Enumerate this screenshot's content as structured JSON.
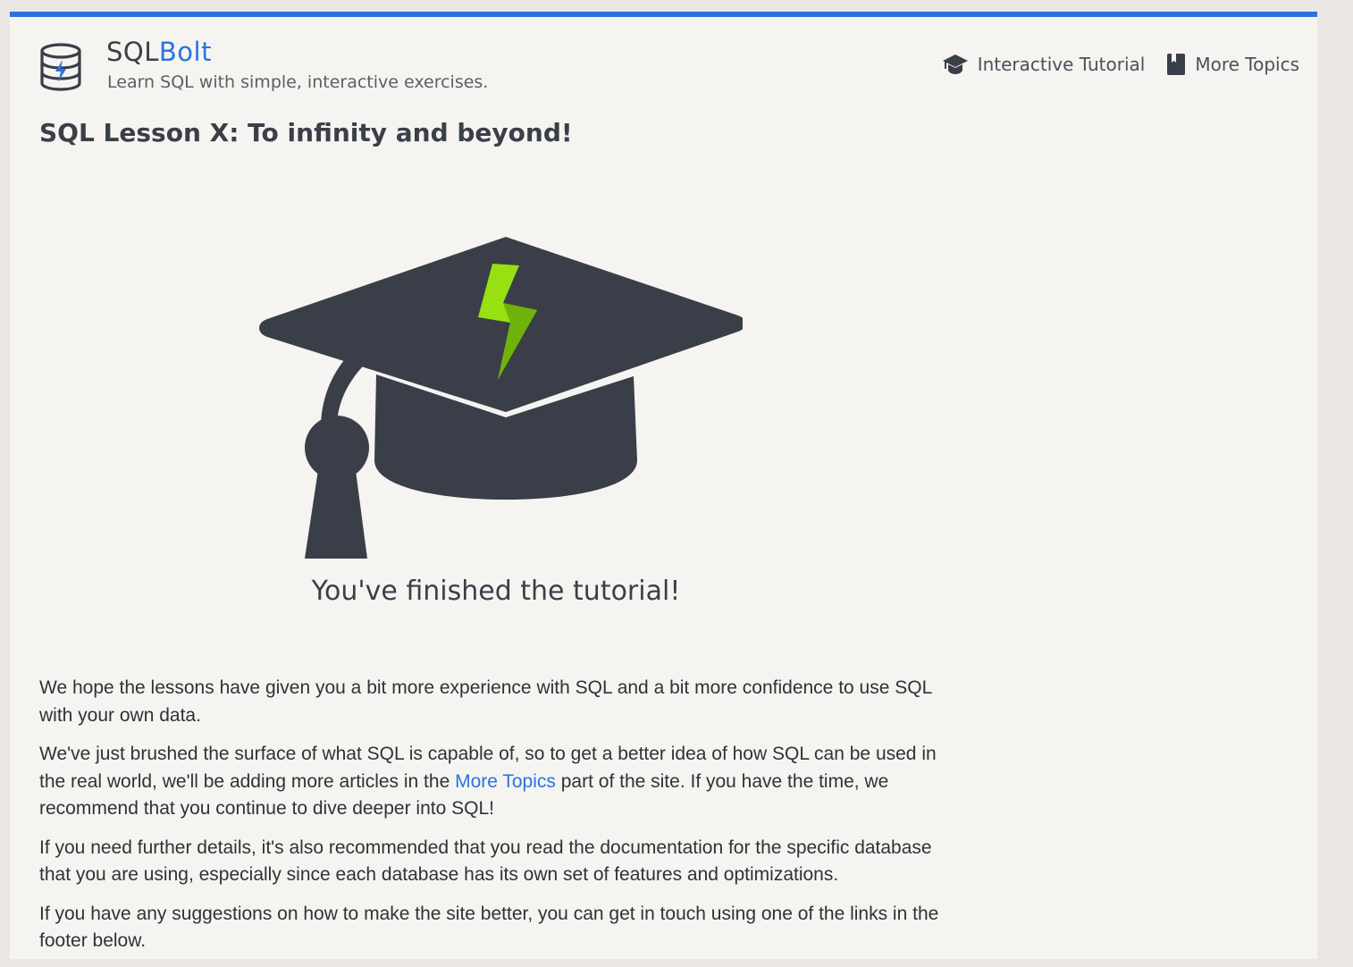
{
  "header": {
    "brand_prefix": "SQL",
    "brand_suffix": "Bolt",
    "tagline": "Learn SQL with simple, interactive exercises.",
    "nav": [
      {
        "label": "Interactive Tutorial",
        "icon": "graduation-cap-icon"
      },
      {
        "label": "More Topics",
        "icon": "book-icon"
      }
    ]
  },
  "lesson": {
    "title": "SQL Lesson X: To infinity and beyond!",
    "hero_caption": "You've finished the tutorial!"
  },
  "body": {
    "p1": "We hope the lessons have given you a bit more experience with SQL and a bit more confidence to use SQL with your own data.",
    "p2_before": "We've just brushed the surface of what SQL is capable of, so to get a better idea of how SQL can be used in the real world, we'll be adding more articles in the ",
    "p2_link": "More Topics",
    "p2_after": " part of the site. If you have the time, we recommend that you continue to dive deeper into SQL!",
    "p3": "If you need further details, it's also recommended that you read the documentation for the specific database that you are using, especially since each database has its own set of features and optimizations.",
    "p4": "If you have any suggestions on how to make the site better, you can get in touch using one of the links in the footer below."
  },
  "colors": {
    "accent": "#2b72e0",
    "cap": "#3a3e48",
    "bolt": "#97e012"
  }
}
